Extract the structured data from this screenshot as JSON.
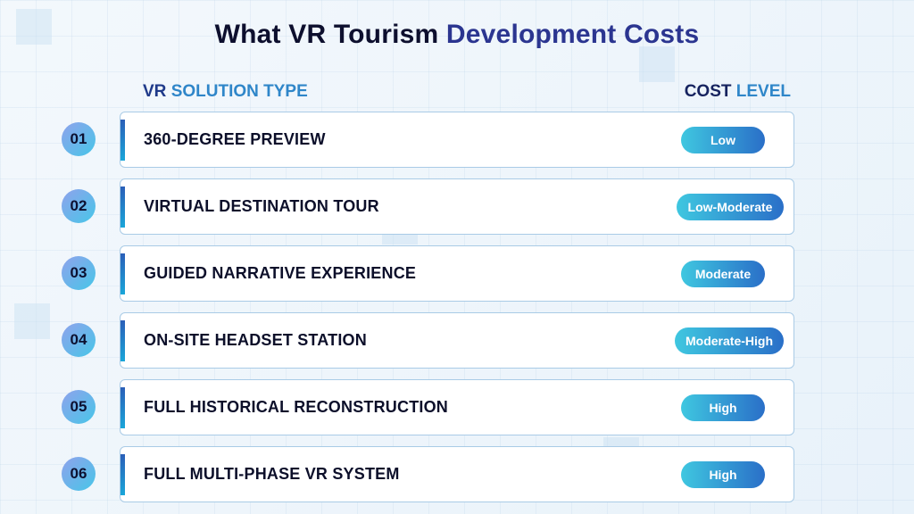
{
  "title": {
    "main": "What VR Tourism",
    "accent": "Development Costs"
  },
  "headers": {
    "left_main": "VR",
    "left_accent": "SOLUTION TYPE",
    "right_main": "COST",
    "right_accent": "LEVEL"
  },
  "rows": [
    {
      "number": "01",
      "label": "360-DEGREE PREVIEW",
      "cost": "Low"
    },
    {
      "number": "02",
      "label": "VIRTUAL DESTINATION TOUR",
      "cost": "Low-Moderate"
    },
    {
      "number": "03",
      "label": "GUIDED NARRATIVE EXPERIENCE",
      "cost": "Moderate"
    },
    {
      "number": "04",
      "label": "ON-SITE HEADSET STATION",
      "cost": "Moderate-High"
    },
    {
      "number": "05",
      "label": "FULL HISTORICAL RECONSTRUCTION",
      "cost": "High"
    },
    {
      "number": "06",
      "label": "FULL MULTI-PHASE VR SYSTEM",
      "cost": "High"
    }
  ],
  "colors": {
    "title_accent": "#2b3590",
    "header_accent": "#2f86c9",
    "pill_start": "#3fc7e0",
    "pill_end": "#2a6fc8"
  }
}
